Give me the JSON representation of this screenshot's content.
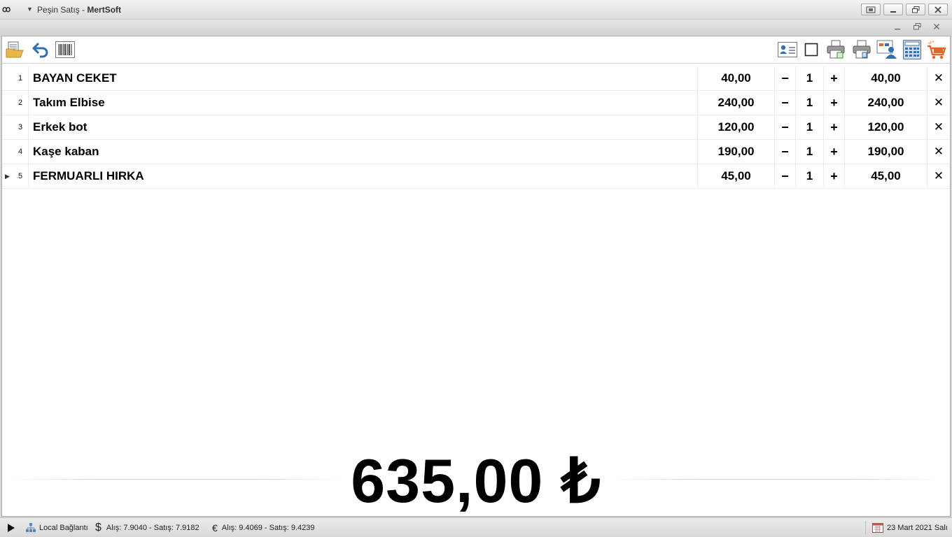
{
  "window": {
    "logo": "ꝏ",
    "title_main": "Peşin Satış",
    "title_sep": " - ",
    "title_app": "MertSoft"
  },
  "sale_items": [
    {
      "no": "1",
      "name": "BAYAN CEKET",
      "price": "40,00",
      "qty": "1",
      "total": "40,00"
    },
    {
      "no": "2",
      "name": "Takım Elbise",
      "price": "240,00",
      "qty": "1",
      "total": "240,00"
    },
    {
      "no": "3",
      "name": "Erkek bot",
      "price": "120,00",
      "qty": "1",
      "total": "120,00"
    },
    {
      "no": "4",
      "name": "Kaşe kaban",
      "price": "190,00",
      "qty": "1",
      "total": "190,00"
    },
    {
      "no": "5",
      "name": "FERMUARLI HIRKA",
      "price": "45,00",
      "qty": "1",
      "total": "45,00"
    }
  ],
  "row_controls": {
    "minus": "−",
    "plus": "+",
    "delete": "✕",
    "current_row_indicator": "▶"
  },
  "grand_total": "635,00 ₺",
  "status": {
    "connection": "Local Bağlantı",
    "usd_symbol": "$",
    "usd_rates": "Alış: 7.9040  -  Satış: 7.9182",
    "eur_symbol": "€",
    "eur_rates": "Alış: 9.4069  -  Satış: 9.4239",
    "date": "23 Mart 2021 Salı"
  },
  "colors": {
    "accent_blue": "#2f6fb3",
    "cart_orange": "#e0662a",
    "folder_yellow": "#e8b84a"
  }
}
